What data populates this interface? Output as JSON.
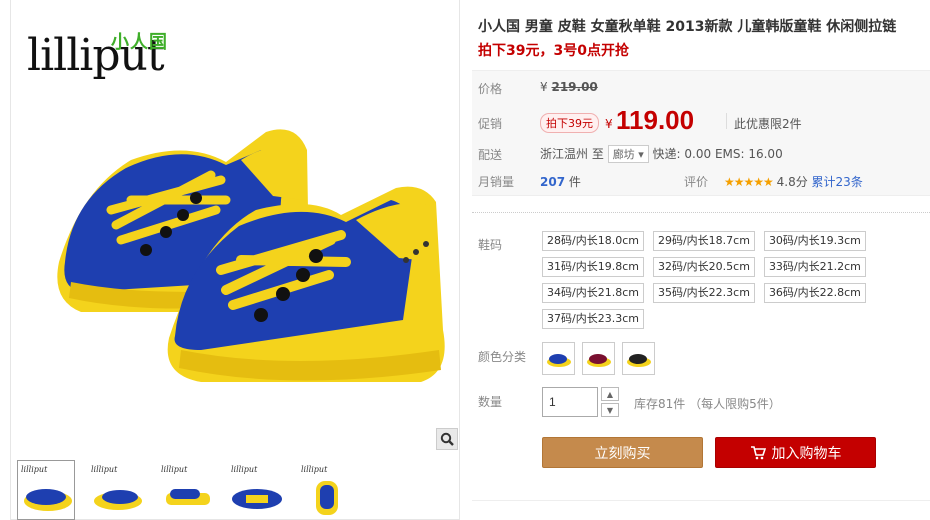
{
  "gallery": {
    "brand_cn": "小人国",
    "brand_en": "lilliput",
    "thumb_brand": "lilliput",
    "thumbs": [
      "thumb-1",
      "thumb-2",
      "thumb-3",
      "thumb-4",
      "thumb-5"
    ],
    "active_thumb": 0
  },
  "product": {
    "title": "小人国 男童 皮鞋 女童秋单鞋 2013新款 儿童韩版童鞋 休闲侧拉链",
    "promo": "拍下39元，3号0点开抢"
  },
  "price": {
    "orig_label": "价格",
    "currency": "¥",
    "orig_value": "219.00",
    "promo_label": "促销",
    "promo_tag": "拍下39元",
    "promo_currency": "¥",
    "promo_value": "119.00",
    "limit": "此优惠限2件",
    "ship_label": "配送",
    "ship_from": "浙江温州",
    "ship_to_word": "至",
    "ship_dest": "廊坊",
    "ship_fee": "快递: 0.00 EMS: 16.00",
    "sales_label": "月销量",
    "sales_value": "207",
    "sales_unit": "件",
    "review_label": "评价",
    "stars": "★★★★★",
    "rating": "4.8分",
    "reviews": "累计23条"
  },
  "options": {
    "size_label": "鞋码",
    "sizes": [
      "28码/内长18.0cm",
      "29码/内长18.7cm",
      "30码/内长19.3cm",
      "31码/内长19.8cm",
      "32码/内长20.5cm",
      "33码/内长21.2cm",
      "34码/内长21.8cm",
      "35码/内长22.3cm",
      "36码/内长22.8cm",
      "37码/内长23.3cm"
    ],
    "color_label": "颜色分类",
    "colors": [
      "#1e3fb0",
      "#7a1030",
      "#222222"
    ],
    "qty_label": "数量",
    "qty_value": "1",
    "stock": "库存81件 （每人限购5件）"
  },
  "buttons": {
    "buy": "立刻购买",
    "cart": "加入购物车"
  },
  "theme": {
    "accent_red": "#c40000",
    "buy_brown": "#c58a4c",
    "shoe_blue": "#1e3fb0",
    "shoe_yellow": "#f4d31c"
  }
}
